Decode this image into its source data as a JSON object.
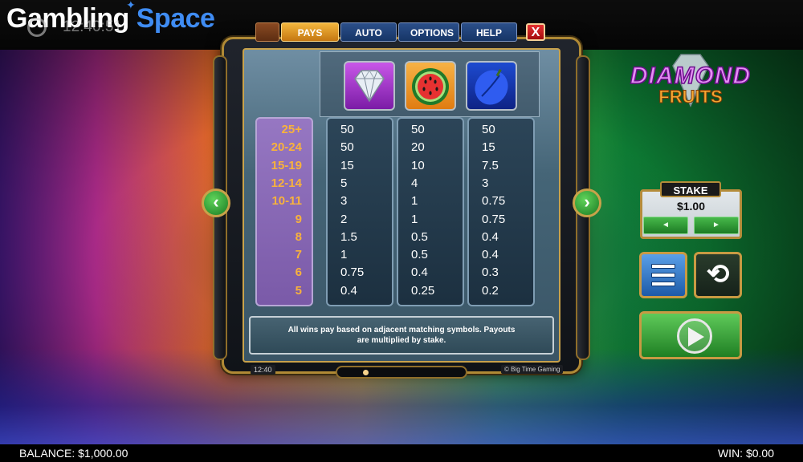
{
  "site": {
    "logo_part1": "Gambling",
    "logo_part2": "Space",
    "clock": "12:40:51"
  },
  "tabs": [
    {
      "label": ""
    },
    {
      "label": "PAYS",
      "active": true
    },
    {
      "label": "AUTO"
    },
    {
      "label": "OPTIONS"
    },
    {
      "label": "HELP"
    }
  ],
  "close_label": "X",
  "game_logo": {
    "line1": "DIAMOND",
    "line2": "FRUITS"
  },
  "symbols": [
    {
      "icon": "diamond-icon"
    },
    {
      "icon": "watermelon-icon"
    },
    {
      "icon": "plum-icon"
    }
  ],
  "paytable": {
    "ranges": [
      "25+",
      "20-24",
      "15-19",
      "12-14",
      "10-11",
      "9",
      "8",
      "7",
      "6",
      "5"
    ],
    "columns": [
      [
        "50",
        "50",
        "15",
        "5",
        "3",
        "2",
        "1.5",
        "1",
        "0.75",
        "0.4"
      ],
      [
        "50",
        "20",
        "10",
        "4",
        "1",
        "1",
        "0.5",
        "0.5",
        "0.4",
        "0.25"
      ],
      [
        "50",
        "15",
        "7.5",
        "3",
        "0.75",
        "0.75",
        "0.4",
        "0.4",
        "0.3",
        "0.2"
      ]
    ]
  },
  "info_text": "All wins pay based on adjacent matching symbols. Payouts are multiplied by stake.",
  "frame_time": "12:40",
  "frame_brand": "© Big Time Gaming",
  "stake": {
    "label": "STAKE",
    "value": "$1.00",
    "down": "◄",
    "up": "►"
  },
  "status": {
    "balance": "BALANCE: $1,000.00",
    "win": "WIN: $0.00"
  },
  "colors": {
    "accent_gold": "#c89a43",
    "tab_active": "#e79a26",
    "range_text": "#f8b23c",
    "brand_blue": "#3f8cf3"
  }
}
